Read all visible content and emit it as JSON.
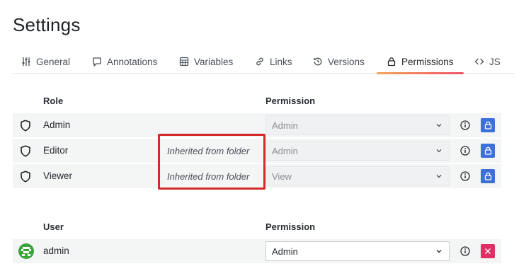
{
  "page": {
    "title": "Settings"
  },
  "tabs": [
    {
      "label": "General",
      "icon": "sliders-icon"
    },
    {
      "label": "Annotations",
      "icon": "comment-icon"
    },
    {
      "label": "Variables",
      "icon": "calculator-icon"
    },
    {
      "label": "Links",
      "icon": "link-icon"
    },
    {
      "label": "Versions",
      "icon": "history-icon"
    },
    {
      "label": "Permissions",
      "icon": "lock-icon",
      "active": true
    },
    {
      "label": "JS",
      "icon": "code-icon"
    }
  ],
  "roles_table": {
    "role_header": "Role",
    "permission_header": "Permission",
    "rows": [
      {
        "name": "Admin",
        "note": "",
        "permission": "Admin"
      },
      {
        "name": "Editor",
        "note": "Inherited from folder",
        "permission": "Admin"
      },
      {
        "name": "Viewer",
        "note": "Inherited from folder",
        "permission": "View"
      }
    ]
  },
  "users_table": {
    "user_header": "User",
    "permission_header": "Permission",
    "rows": [
      {
        "name": "admin",
        "permission": "Admin"
      }
    ]
  },
  "colors": {
    "tab_underline_start": "#f5a55a",
    "tab_underline_end": "#f0556a",
    "lock_button": "#3d71d9",
    "remove_button": "#e02f64",
    "highlight_box": "#d42a2a",
    "avatar": "#3ba43b"
  }
}
